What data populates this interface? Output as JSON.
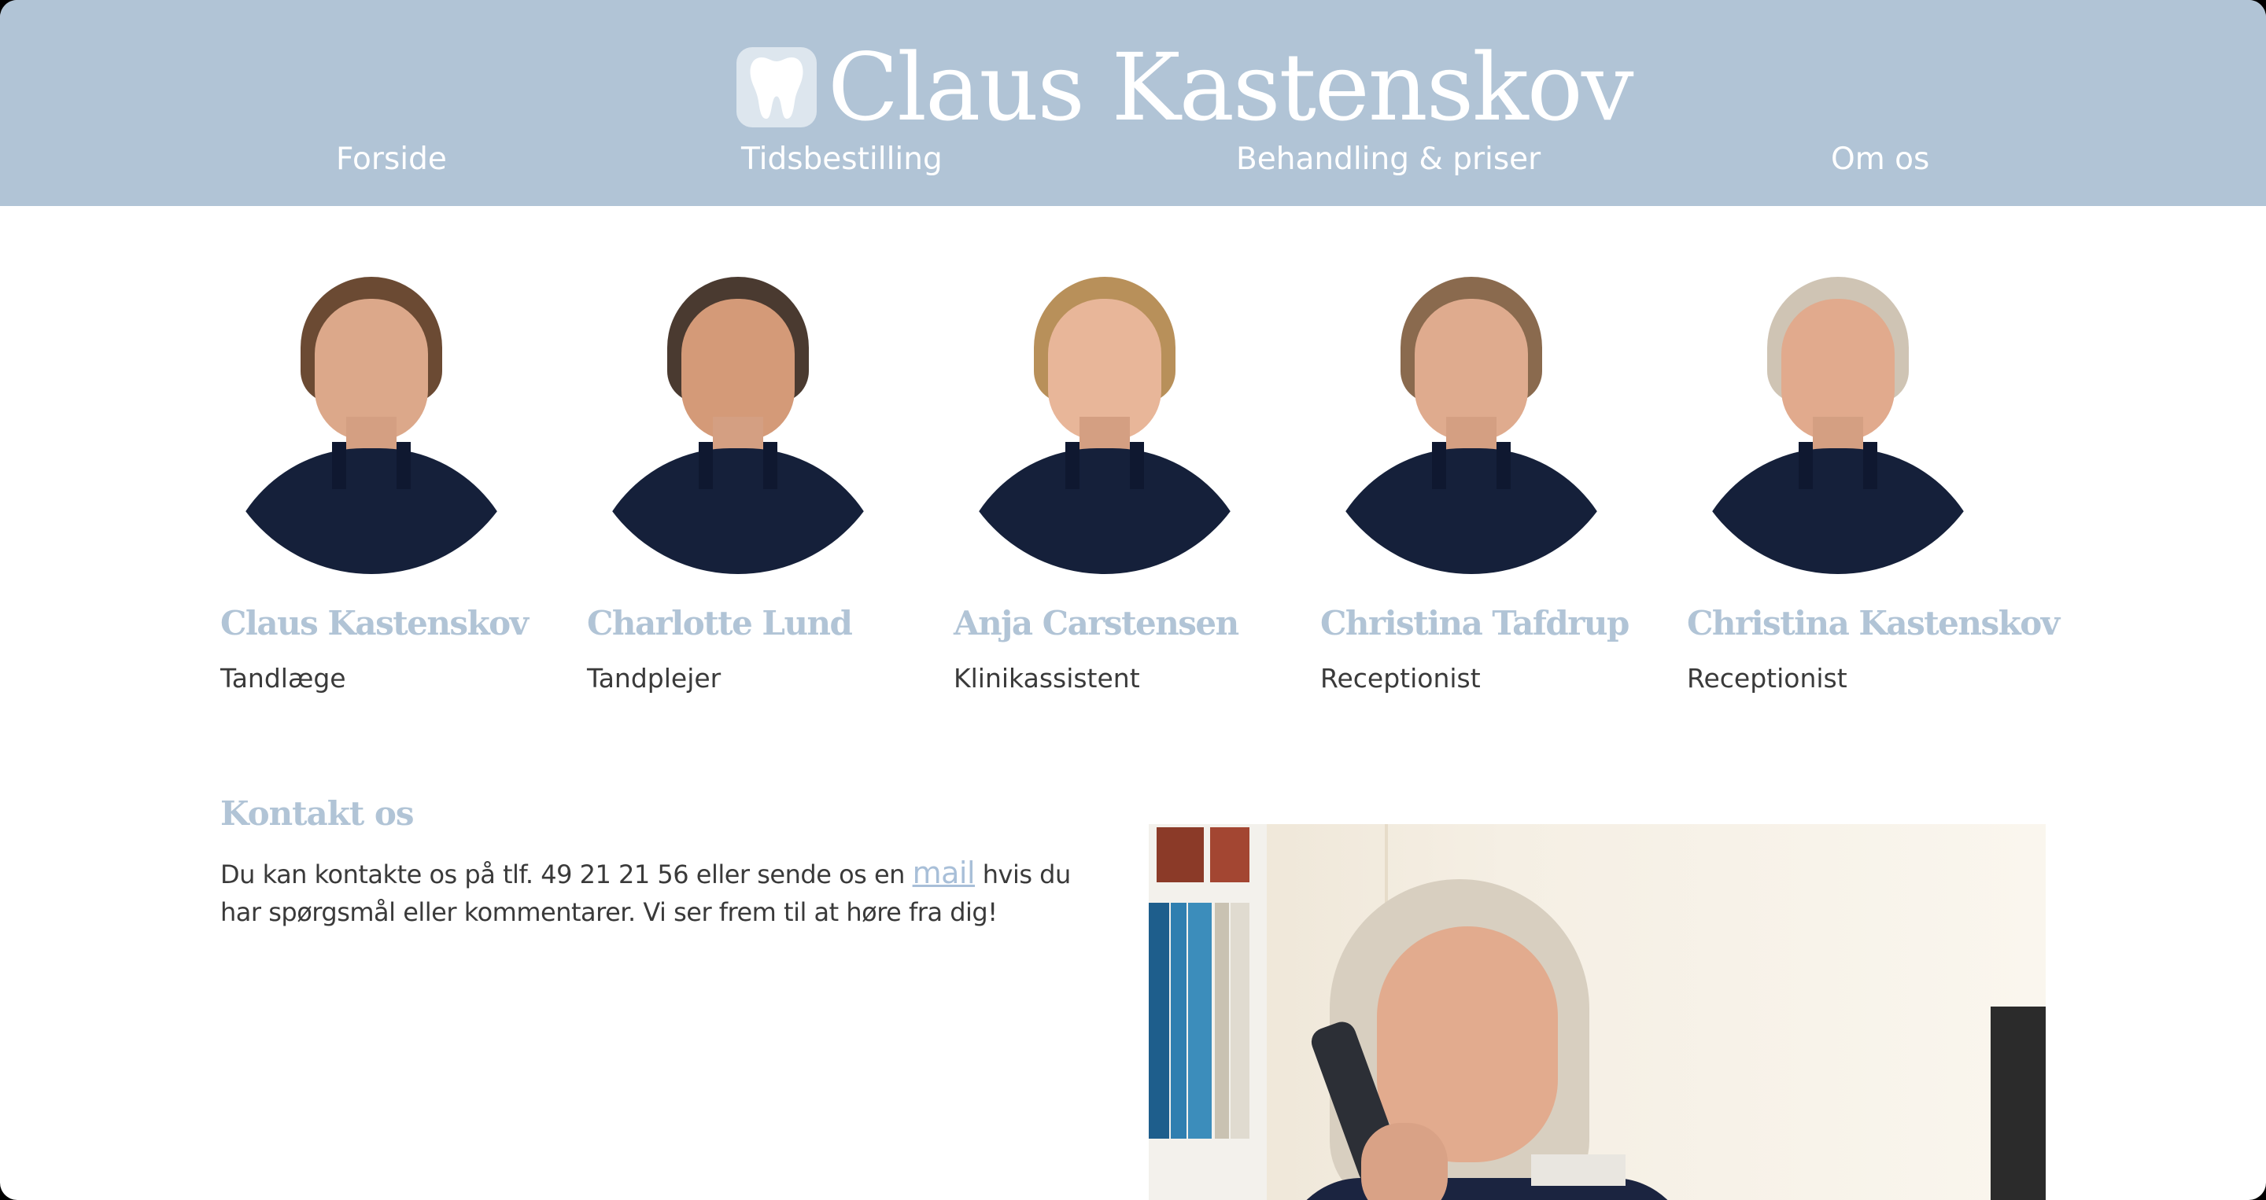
{
  "brand": {
    "title": "Claus Kastenskov",
    "logo_icon": "tooth-icon",
    "header_color": "#b1c4d6",
    "accent_color": "#b1c4d6"
  },
  "nav": {
    "items": [
      {
        "label": "Forside"
      },
      {
        "label": "Tidsbestilling"
      },
      {
        "label": "Behandling & priser"
      },
      {
        "label": "Om os"
      }
    ]
  },
  "team": [
    {
      "name": "Claus Kastenskov",
      "role": "Tandlæge"
    },
    {
      "name": "Charlotte Lund",
      "role": "Tandplejer"
    },
    {
      "name": "Anja Carstensen",
      "role": "Klinikassistent"
    },
    {
      "name": "Christina Tafdrup",
      "role": "Receptionist"
    },
    {
      "name": "Christina Kastenskov",
      "role": "Receptionist"
    }
  ],
  "contact": {
    "title": "Kontakt os",
    "text_before": "Du kan kontakte os på tlf. 49 21 21 56 eller sende os en ",
    "mail_link": "mail",
    "text_after": " hvis du har spørgsmål eller kommentarer. Vi ser frem til at høre fra dig!"
  }
}
